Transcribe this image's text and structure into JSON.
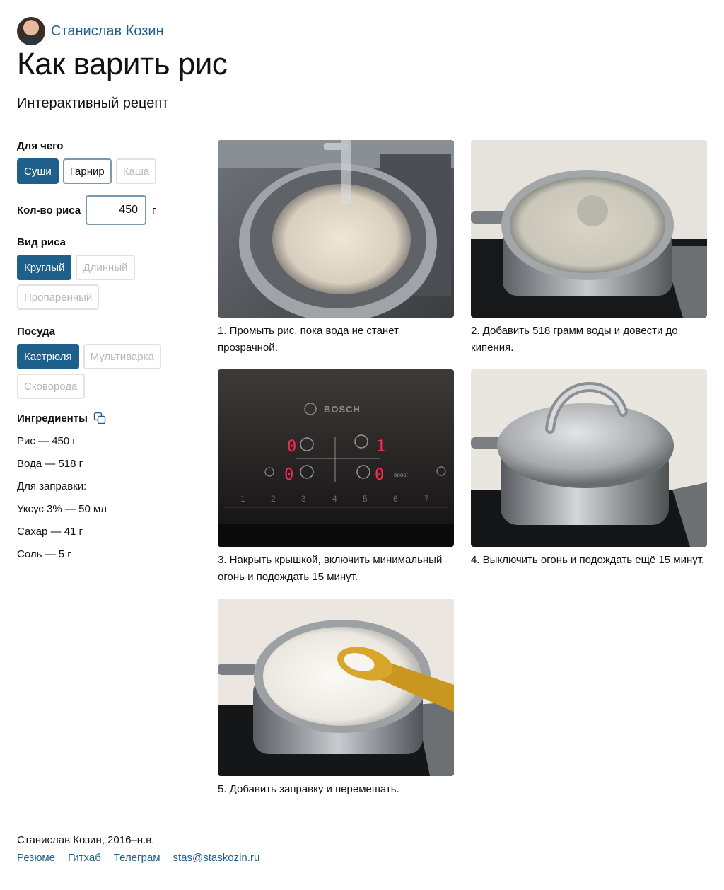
{
  "author": {
    "name": "Станислав Козин"
  },
  "page": {
    "title": "Как варить рис",
    "subtitle": "Интерактивный рецепт"
  },
  "purpose": {
    "label": "Для чего",
    "options": [
      {
        "label": "Суши",
        "state": "active"
      },
      {
        "label": "Гарнир",
        "state": "normal"
      },
      {
        "label": "Каша",
        "state": "disabled"
      }
    ]
  },
  "amount": {
    "label": "Кол-во риса",
    "value": "450",
    "unit": "г"
  },
  "rice_type": {
    "label": "Вид риса",
    "options": [
      {
        "label": "Круглый",
        "state": "active"
      },
      {
        "label": "Длинный",
        "state": "disabled"
      },
      {
        "label": "Пропаренный",
        "state": "disabled"
      }
    ]
  },
  "cookware": {
    "label": "Посуда",
    "options": [
      {
        "label": "Кастрюля",
        "state": "active"
      },
      {
        "label": "Мультиварка",
        "state": "disabled"
      },
      {
        "label": "Сковорода",
        "state": "disabled"
      }
    ]
  },
  "ingredients": {
    "label": "Ингредиенты",
    "items": [
      "Рис — 450 г",
      "Вода — 518 г",
      "Для заправки:",
      "Уксус 3% — 50 мл",
      "Сахар — 41 г",
      "Соль — 5 г"
    ]
  },
  "steps": [
    {
      "caption": "1. Промыть рис, пока вода не станет прозрачной."
    },
    {
      "caption": "2. Добавить 518 грамм воды и довести до кипения."
    },
    {
      "caption": "3. Накрыть крышкой, включить минимальный огонь и подождать 15 минут."
    },
    {
      "caption": "4. Выключить огонь и подождать ещё 15 минут."
    },
    {
      "caption": "5. Добавить заправку и перемешать."
    }
  ],
  "stove": {
    "brand": "BOSCH",
    "boost": "boost",
    "digits": [
      "0",
      "1",
      "0",
      "0"
    ],
    "scale": [
      "1",
      "2",
      "3",
      "4",
      "5",
      "6",
      "7"
    ]
  },
  "footer": {
    "copyright": "Станислав Козин, 2016–н.в.",
    "links": [
      "Резюме",
      "Гитхаб",
      "Телеграм",
      "stas@staskozin.ru"
    ]
  }
}
